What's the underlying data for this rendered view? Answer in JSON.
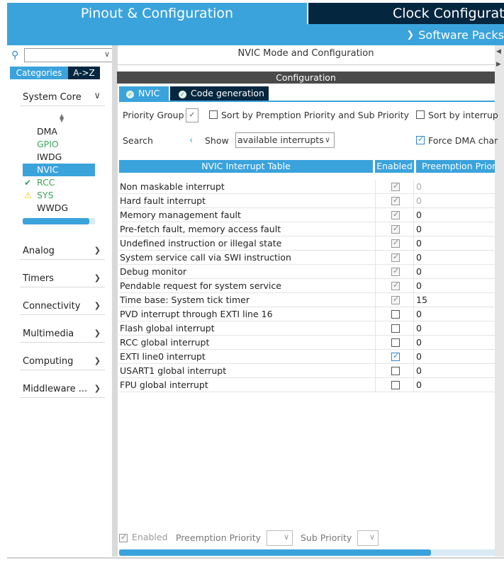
{
  "top_tabs": {
    "pinout": "Pinout & Configuration",
    "clock": "Clock Configurati"
  },
  "software_packs": "Software Packs",
  "left": {
    "search_value": "",
    "tab_categories": "Categories",
    "tab_az": "A->Z",
    "system_core": "System Core",
    "core_items": [
      {
        "label": "DMA",
        "state": "normal"
      },
      {
        "label": "GPIO",
        "state": "green"
      },
      {
        "label": "IWDG",
        "state": "normal"
      },
      {
        "label": "NVIC",
        "state": "selected"
      },
      {
        "label": "RCC",
        "state": "check"
      },
      {
        "label": "SYS",
        "state": "warning"
      },
      {
        "label": "WWDG",
        "state": "normal"
      }
    ],
    "core_scroll_fraction": 0.92,
    "categories": [
      "Analog",
      "Timers",
      "Connectivity",
      "Multimedia",
      "Computing",
      "Middleware ..."
    ]
  },
  "right": {
    "mode_title": "NVIC Mode and Configuration",
    "config_title": "Configuration",
    "subtab_nvic": "NVIC",
    "subtab_codegen": "Code generation",
    "priority_group_label": "Priority Group",
    "priority_group_value": "✓",
    "sort_preempt_label": "Sort by Premption Priority and Sub Priority",
    "sort_interrupt_label": "Sort by interrup",
    "search_label": "Search",
    "show_label": "Show",
    "show_value": "available interrupts",
    "force_dma_label": "Force DMA char",
    "table": {
      "headers": [
        "NVIC Interrupt Table",
        "Enabled",
        "Preemption Prior"
      ],
      "rows": [
        {
          "name": "Non maskable interrupt",
          "enabled": "locked",
          "preempt": "0",
          "dim": true
        },
        {
          "name": "Hard fault interrupt",
          "enabled": "locked",
          "preempt": "0",
          "dim": true
        },
        {
          "name": "Memory management fault",
          "enabled": "locked",
          "preempt": "0",
          "dim": false
        },
        {
          "name": "Pre-fetch fault, memory access fault",
          "enabled": "locked",
          "preempt": "0",
          "dim": false
        },
        {
          "name": "Undefined instruction or illegal state",
          "enabled": "locked",
          "preempt": "0",
          "dim": false
        },
        {
          "name": "System service call via SWI instruction",
          "enabled": "locked",
          "preempt": "0",
          "dim": false
        },
        {
          "name": "Debug monitor",
          "enabled": "locked",
          "preempt": "0",
          "dim": false
        },
        {
          "name": "Pendable request for system service",
          "enabled": "locked",
          "preempt": "0",
          "dim": false
        },
        {
          "name": "Time base: System tick timer",
          "enabled": "locked",
          "preempt": "15",
          "dim": false
        },
        {
          "name": "PVD interrupt through EXTI line 16",
          "enabled": "off",
          "preempt": "0",
          "dim": false
        },
        {
          "name": "Flash global interrupt",
          "enabled": "off",
          "preempt": "0",
          "dim": false
        },
        {
          "name": "RCC global interrupt",
          "enabled": "off",
          "preempt": "0",
          "dim": false
        },
        {
          "name": "EXTI line0 interrupt",
          "enabled": "on",
          "preempt": "0",
          "dim": false
        },
        {
          "name": "USART1 global interrupt",
          "enabled": "off",
          "preempt": "0",
          "dim": false
        },
        {
          "name": "FPU global interrupt",
          "enabled": "off",
          "preempt": "0",
          "dim": false
        }
      ]
    },
    "bottom": {
      "enabled_label": "Enabled",
      "preempt_label": "Preemption Priority",
      "sub_label": "Sub Priority"
    },
    "hscroll_fraction": 0.83
  },
  "colors": {
    "accent": "#3aa3dc",
    "dark": "#05263f",
    "green": "#3da35d",
    "warning": "#f2c200"
  }
}
